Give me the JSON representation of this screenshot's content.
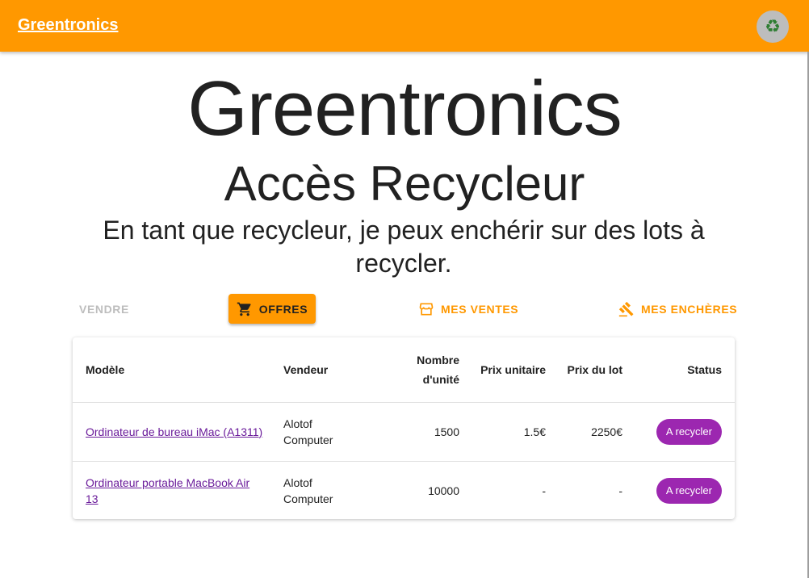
{
  "appbar": {
    "brand": "Greentronics",
    "avatar_icon": "recycle-icon"
  },
  "hero": {
    "title": "Greentronics",
    "subtitle": "Accès Recycleur",
    "description": "En tant que recycleur, je peux enchérir sur des lots à recycler."
  },
  "nav": {
    "vendre": "VENDRE",
    "offres": "OFFRES",
    "mes_ventes": "MES VENTES",
    "mes_encheres": "MES ENCHÈRES"
  },
  "table": {
    "headers": {
      "modele": "Modèle",
      "vendeur": "Vendeur",
      "nombre": "Nombre d'unité",
      "prix_unitaire": "Prix unitaire",
      "prix_lot": "Prix du lot",
      "status": "Status"
    },
    "rows": [
      {
        "modele": "Ordinateur de bureau iMac (A1311)",
        "vendeur": "Alotof Computer",
        "nombre": "1500",
        "prix_unitaire": "1.5€",
        "prix_lot": "2250€",
        "status": "A recycler"
      },
      {
        "modele": "Ordinateur portable MacBook Air 13",
        "vendeur": "Alotof Computer",
        "nombre": "10000",
        "prix_unitaire": "-",
        "prix_lot": "-",
        "status": "A recycler"
      }
    ]
  },
  "colors": {
    "primary": "#ff9800",
    "accent": "#9c27b0",
    "link": "#6a1b9a",
    "disabled": "#bdbdbd"
  }
}
